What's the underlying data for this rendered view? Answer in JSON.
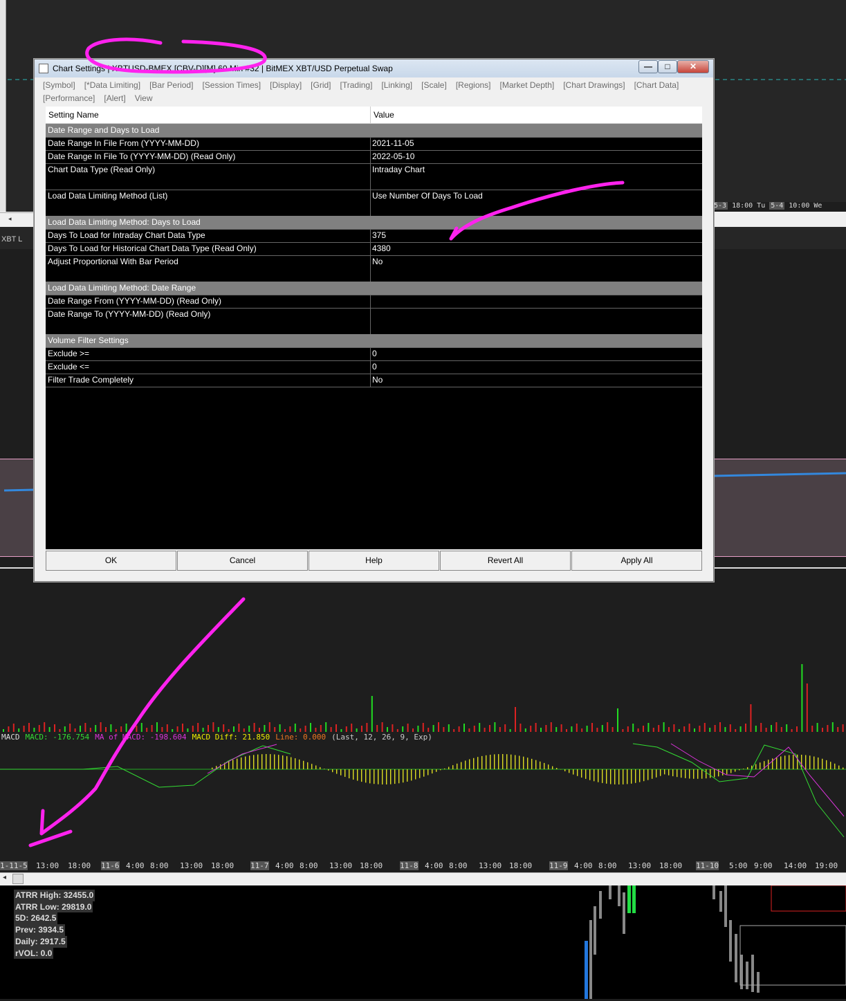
{
  "background": {
    "top_time_labels": [
      "5-3",
      "18:00",
      "Tu",
      "5-4",
      "10:00",
      "We"
    ],
    "mid_tab_label": "XBT L",
    "macd_legend": [
      {
        "text": "MACD",
        "color": "#dddddd"
      },
      {
        "text": "MACD: -176.754",
        "color": "#33dd33"
      },
      {
        "text": "MA of MACD: -198.604",
        "color": "#dd33dd"
      },
      {
        "text": "MACD Diff: 21.850",
        "color": "#eeee00"
      },
      {
        "text": "Line: 0.000",
        "color": "#ee7722"
      },
      {
        "text": "(Last, 12, 26, 9, Exp)",
        "color": "#cccccc"
      }
    ],
    "bottom_time_labels": [
      {
        "text": "1-11-5",
        "hl": true
      },
      {
        "text": "13:00"
      },
      {
        "text": "18:00"
      },
      {
        "text": "11-6",
        "hl": true
      },
      {
        "text": "4:00"
      },
      {
        "text": "8:00"
      },
      {
        "text": "13:00"
      },
      {
        "text": "18:00"
      },
      {
        "text": "11-7",
        "hl": true
      },
      {
        "text": "4:00"
      },
      {
        "text": "8:00"
      },
      {
        "text": "13:00"
      },
      {
        "text": "18:00"
      },
      {
        "text": "11-8",
        "hl": true
      },
      {
        "text": "4:00"
      },
      {
        "text": "8:00"
      },
      {
        "text": "13:00"
      },
      {
        "text": "18:00"
      },
      {
        "text": "11-9",
        "hl": true
      },
      {
        "text": "4:00"
      },
      {
        "text": "8:00"
      },
      {
        "text": "13:00"
      },
      {
        "text": "18:00"
      },
      {
        "text": "11-10",
        "hl": true
      },
      {
        "text": "5:00"
      },
      {
        "text": "9:00"
      },
      {
        "text": "14:00"
      },
      {
        "text": "19:00"
      }
    ],
    "stats": [
      "ATRR High: 32455.0",
      "ATRR Low: 29819.0",
      "5D: 2642.5",
      "Prev: 3934.5",
      "Daily: 2917.5",
      "rVOL: 0.0"
    ]
  },
  "dialog": {
    "title": "Chart Settings | XBTUSD-BMEX [CBV-D][M]  60 Min  #32 | BitMEX XBT/USD Perpetual Swap",
    "window_buttons": {
      "minimize": "—",
      "maximize": "□",
      "close": "✕"
    },
    "tabs": [
      "[Symbol]",
      "[*Data Limiting]",
      "[Bar Period]",
      "[Session Times]",
      "[Display]",
      "[Grid]",
      "[Trading]",
      "[Linking]",
      "[Scale]",
      "[Regions]",
      "[Market Depth]",
      "[Chart Drawings]",
      "[Chart Data]",
      "[Performance]",
      "[Alert]",
      "View"
    ],
    "grid": {
      "header_name": "Setting Name",
      "header_value": "Value",
      "rows": [
        {
          "type": "section",
          "name": "Date Range and Days to Load",
          "value": ""
        },
        {
          "type": "row",
          "name": "Date Range In File From (YYYY-MM-DD)",
          "value": "2021-11-05"
        },
        {
          "type": "row",
          "name": "Date Range In File To (YYYY-MM-DD) (Read Only)",
          "value": "2022-05-10"
        },
        {
          "type": "row",
          "name": "Chart Data Type (Read Only)",
          "value": "Intraday Chart"
        },
        {
          "type": "blank",
          "name": "",
          "value": ""
        },
        {
          "type": "row",
          "name": "Load Data Limiting Method (List)",
          "value": "Use Number Of Days To Load"
        },
        {
          "type": "blank",
          "name": "",
          "value": ""
        },
        {
          "type": "section",
          "name": "Load Data Limiting Method: Days to Load",
          "value": ""
        },
        {
          "type": "row",
          "name": "Days To Load for Intraday Chart Data Type",
          "value": "375"
        },
        {
          "type": "row",
          "name": "Days To Load for Historical Chart Data Type (Read Only)",
          "value": "4380"
        },
        {
          "type": "row",
          "name": "Adjust Proportional With Bar Period",
          "value": "No"
        },
        {
          "type": "blank",
          "name": "",
          "value": ""
        },
        {
          "type": "section",
          "name": "Load Data Limiting Method: Date Range",
          "value": ""
        },
        {
          "type": "row",
          "name": "Date Range From (YYYY-MM-DD) (Read Only)",
          "value": ""
        },
        {
          "type": "row",
          "name": "Date Range To (YYYY-MM-DD) (Read Only)",
          "value": ""
        },
        {
          "type": "blank",
          "name": "",
          "value": ""
        },
        {
          "type": "section",
          "name": "Volume Filter Settings",
          "value": ""
        },
        {
          "type": "row",
          "name": "Exclude >=",
          "value": "0"
        },
        {
          "type": "row",
          "name": "Exclude <=",
          "value": "0"
        },
        {
          "type": "row",
          "name": "Filter Trade Completely",
          "value": "No"
        }
      ]
    },
    "buttons": {
      "ok": "OK",
      "cancel": "Cancel",
      "help": "Help",
      "revert_all": "Revert All",
      "apply_all": "Apply All"
    }
  },
  "colors": {
    "annotation": "#ff22ee",
    "section_bg": "#808080",
    "grid_bg": "#000000"
  }
}
